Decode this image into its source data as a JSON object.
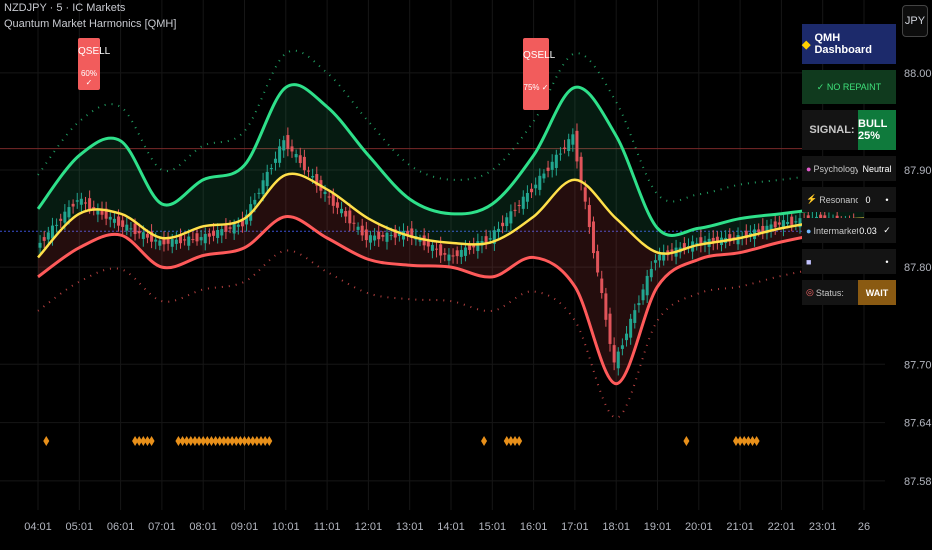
{
  "header": {
    "symbol_line": "NZDJPY · 5 · IC Markets",
    "indicator_line": "Quantum Market Harmonics [QMH]"
  },
  "currency_button": "JPY",
  "dashboard": {
    "title": "QMH Dashboard",
    "repaint": "✓ NO REPAINT",
    "signal_label": "SIGNAL:",
    "signal_value": "BULL 25%",
    "rows": [
      {
        "label": "Psychology:",
        "value": "Neutral",
        "side": ""
      },
      {
        "label": "Resonance:",
        "value": "0",
        "side": "•"
      },
      {
        "label": "Intermarket:",
        "value": "0.03",
        "side": "✓"
      },
      {
        "label": "",
        "value": "",
        "side": "•"
      },
      {
        "label": "Status:",
        "value": "WAIT",
        "side": ""
      }
    ],
    "colors": {
      "title_bg": "#1c2a6b",
      "signal_bg": "#0f7a3c",
      "status_bg": "#8a5a12"
    }
  },
  "signals": [
    {
      "label": "QSELL",
      "pct": "60% ✓",
      "time_index": 2
    },
    {
      "label": "QSELL",
      "pct": "75% ✓",
      "time_index": 13
    }
  ],
  "chart_data": {
    "type": "line",
    "title": "",
    "xlabel": "",
    "ylabel": "",
    "x": [
      "04:01",
      "05:01",
      "06:01",
      "07:01",
      "08:01",
      "09:01",
      "10:01",
      "11:01",
      "12:01",
      "13:01",
      "14:01",
      "15:01",
      "16:01",
      "17:01",
      "18:01",
      "19:01",
      "20:01",
      "21:01",
      "22:01",
      "23:01",
      "26"
    ],
    "ylim": [
      87.55,
      88.075
    ],
    "yticks": [
      88.0,
      87.9,
      87.8,
      87.7,
      87.64,
      87.58
    ],
    "ytick_labels": [
      "88.000",
      "87.900",
      "87.800",
      "87.700",
      "87.640",
      "87.580"
    ],
    "grid": true,
    "price_ref_line": 87.837,
    "resistance_line": 87.922,
    "series": [
      {
        "role": "upper_band",
        "color": "#2ee08a",
        "values": [
          87.86,
          87.915,
          87.93,
          87.865,
          87.89,
          87.905,
          87.985,
          87.965,
          87.915,
          87.87,
          87.855,
          87.865,
          87.915,
          87.985,
          87.935,
          87.84,
          87.84,
          87.85,
          87.855,
          87.86,
          87.862
        ]
      },
      {
        "role": "mid_line",
        "color": "#ffe04a",
        "values": [
          87.81,
          87.855,
          87.855,
          87.83,
          87.842,
          87.85,
          87.895,
          87.88,
          87.85,
          87.832,
          87.825,
          87.826,
          87.852,
          87.89,
          87.85,
          87.815,
          87.823,
          87.83,
          87.84,
          87.847,
          87.85
        ]
      },
      {
        "role": "lower_band",
        "color": "#ff5a5a",
        "values": [
          87.79,
          87.82,
          87.833,
          87.8,
          87.812,
          87.82,
          87.852,
          87.83,
          87.808,
          87.802,
          87.8,
          87.79,
          87.81,
          87.78,
          87.68,
          87.78,
          87.808,
          87.815,
          87.826,
          87.834,
          87.836
        ]
      },
      {
        "role": "close",
        "color": "#2ab39a",
        "values": [
          87.82,
          87.87,
          87.845,
          87.825,
          87.83,
          87.845,
          87.93,
          87.875,
          87.83,
          87.835,
          87.81,
          87.83,
          87.88,
          87.935,
          87.7,
          87.81,
          87.825,
          87.83,
          87.845,
          87.85,
          87.84
        ]
      }
    ],
    "divergence_markers": [
      0.2,
      2.35,
      2.45,
      2.55,
      2.65,
      2.75,
      3.4,
      3.5,
      3.6,
      3.7,
      3.8,
      3.9,
      4.0,
      4.1,
      4.2,
      4.3,
      4.4,
      4.5,
      4.6,
      4.7,
      4.8,
      4.9,
      5.0,
      5.1,
      5.2,
      5.3,
      5.4,
      5.5,
      5.6,
      10.8,
      11.35,
      11.45,
      11.55,
      11.65,
      15.7,
      16.9,
      17.0,
      17.1,
      17.2,
      17.3,
      17.4
    ],
    "marker_color": "#e8901a"
  }
}
